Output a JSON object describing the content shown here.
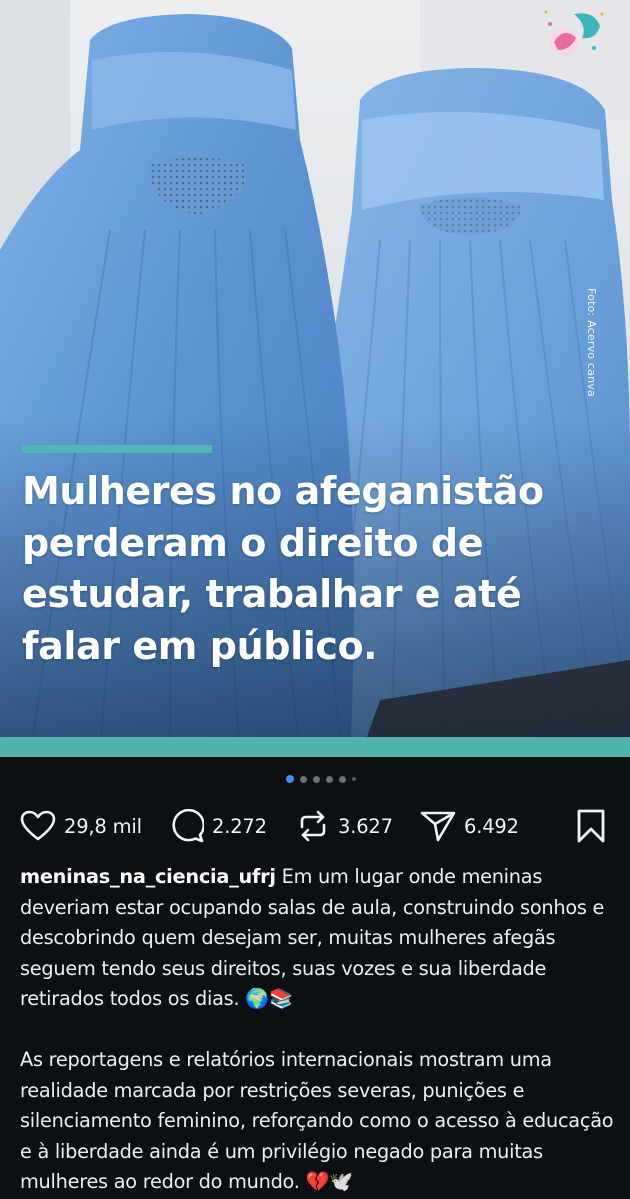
{
  "post": {
    "photo_credit": "Foto: Acervo canva",
    "headline": "Mulheres no afeganistão perderam o direito de estudar, trabalhar e até falar em público.",
    "accent_color": "#4fb3ac",
    "carousel": {
      "total_slides": 6,
      "active_index": 0
    }
  },
  "actions": {
    "likes": "29,8 mil",
    "comments": "2.272",
    "reposts": "3.627",
    "shares": "6.492"
  },
  "caption": {
    "username": "meninas_na_ciencia_ufrj",
    "paragraph1": "Em um lugar onde meninas deveriam estar ocupando salas de aula, construindo sonhos e descobrindo quem desejam ser, muitas mulheres afegãs seguem tendo seus direitos, suas vozes e sua liberdade retirados todos os dias. 🌍📚",
    "paragraph2": "As reportagens e relatórios internacionais mostram uma realidade marcada por restrições severas, punições e silenciamento feminino, reforçando como o acesso à educação e à liberdade ainda é um privilégio negado para muitas mulheres ao redor do mundo. 💔🕊️"
  },
  "icons": {
    "like": "heart-icon",
    "comment": "comment-bubble-icon",
    "repost": "repost-icon",
    "share": "send-icon",
    "bookmark": "bookmark-icon",
    "logo": "meninas-na-ciencia-logo"
  }
}
